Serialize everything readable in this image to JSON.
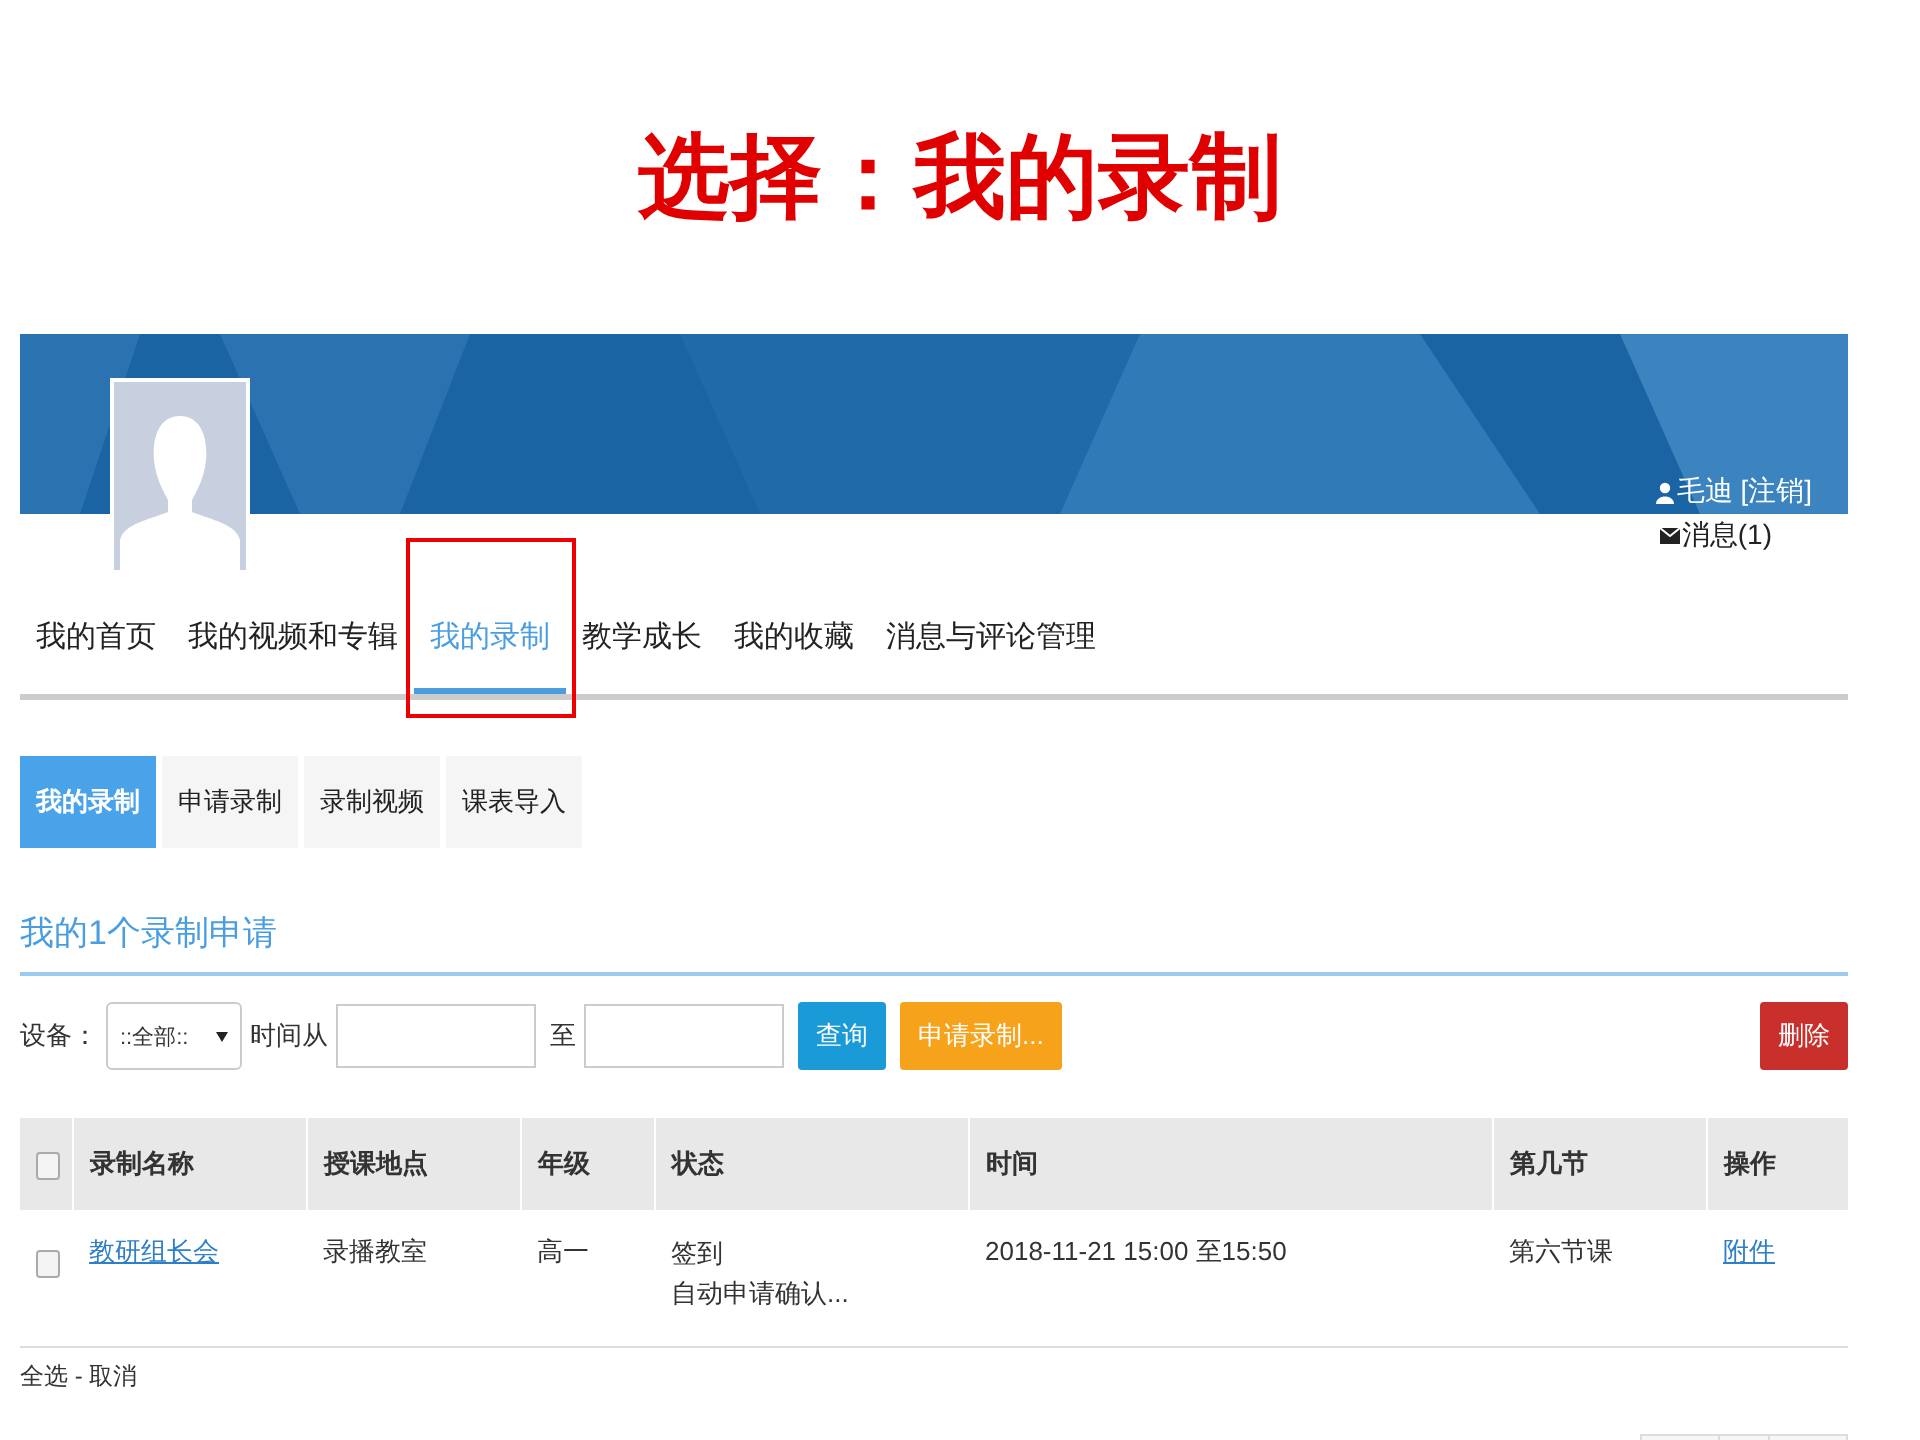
{
  "slide_title": "选择：我的录制",
  "user": {
    "name": "毛迪 [注销]",
    "messages": "消息(1)"
  },
  "nav": [
    {
      "label": "我的首页",
      "selected": false,
      "highlighted": false
    },
    {
      "label": "我的视频和专辑",
      "selected": false,
      "highlighted": false
    },
    {
      "label": "我的录制",
      "selected": true,
      "highlighted": true
    },
    {
      "label": "教学成长",
      "selected": false,
      "highlighted": false
    },
    {
      "label": "我的收藏",
      "selected": false,
      "highlighted": false
    },
    {
      "label": "消息与评论管理",
      "selected": false,
      "highlighted": false
    }
  ],
  "subtabs": [
    {
      "label": "我的录制",
      "selected": true
    },
    {
      "label": "申请录制",
      "selected": false
    },
    {
      "label": "录制视频",
      "selected": false
    },
    {
      "label": "课表导入",
      "selected": false
    }
  ],
  "heading": "我的1个录制申请",
  "filter": {
    "device_label": "设备：",
    "device_value": "::全部::",
    "time_from_label": "时间从",
    "to_label": "至",
    "query_button": "查询",
    "apply_button": "申请录制...",
    "delete_button": "删除"
  },
  "table": {
    "select_all_checked": false,
    "columns": [
      "录制名称",
      "授课地点",
      "年级",
      "状态",
      "时间",
      "第几节",
      "操作"
    ],
    "rows": [
      {
        "checked": false,
        "name": "教研组长会",
        "place": "录播教室",
        "grade": "高一",
        "status": [
          "签到",
          "自动申请确认..."
        ],
        "time": "2018-11-21 15:00 至15:50",
        "period": "第六节课",
        "action": "附件"
      }
    ]
  },
  "select_all": "全选 - 取消"
}
